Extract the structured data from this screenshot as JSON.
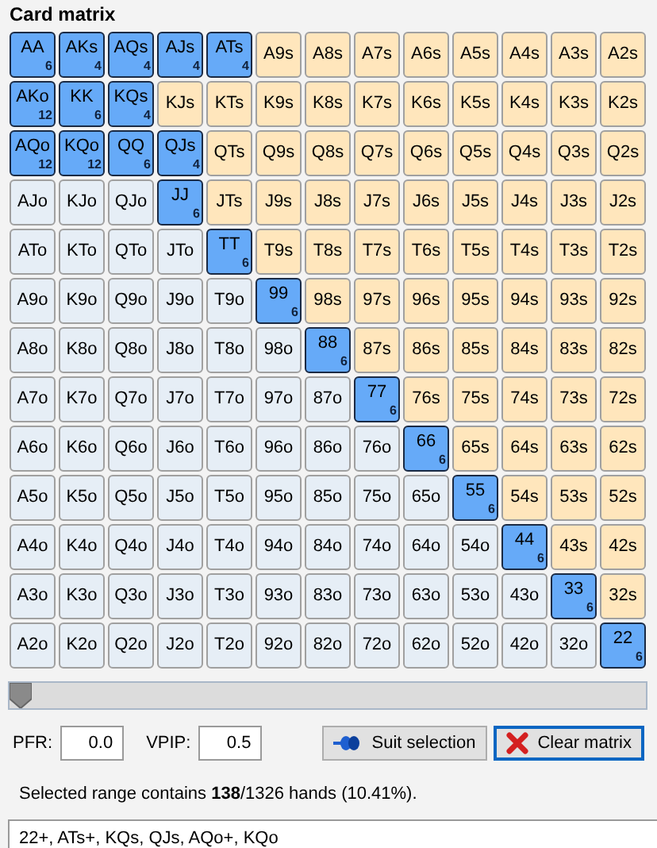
{
  "title": "Card matrix",
  "matrix": [
    [
      {
        "label": "AA",
        "selected": true,
        "combos": "6"
      },
      {
        "label": "AKs",
        "selected": true,
        "combos": "4"
      },
      {
        "label": "AQs",
        "selected": true,
        "combos": "4"
      },
      {
        "label": "AJs",
        "selected": true,
        "combos": "4"
      },
      {
        "label": "ATs",
        "selected": true,
        "combos": "4"
      },
      {
        "label": "A9s",
        "kind": "suited",
        "selected": false
      },
      {
        "label": "A8s",
        "kind": "suited",
        "selected": false
      },
      {
        "label": "A7s",
        "kind": "suited",
        "selected": false
      },
      {
        "label": "A6s",
        "kind": "suited",
        "selected": false
      },
      {
        "label": "A5s",
        "kind": "suited",
        "selected": false
      },
      {
        "label": "A4s",
        "kind": "suited",
        "selected": false
      },
      {
        "label": "A3s",
        "kind": "suited",
        "selected": false
      },
      {
        "label": "A2s",
        "kind": "suited",
        "selected": false
      }
    ],
    [
      {
        "label": "AKo",
        "selected": true,
        "combos": "12"
      },
      {
        "label": "KK",
        "selected": true,
        "combos": "6"
      },
      {
        "label": "KQs",
        "selected": true,
        "combos": "4"
      },
      {
        "label": "KJs",
        "kind": "suited",
        "selected": false
      },
      {
        "label": "KTs",
        "kind": "suited",
        "selected": false
      },
      {
        "label": "K9s",
        "kind": "suited",
        "selected": false
      },
      {
        "label": "K8s",
        "kind": "suited",
        "selected": false
      },
      {
        "label": "K7s",
        "kind": "suited",
        "selected": false
      },
      {
        "label": "K6s",
        "kind": "suited",
        "selected": false
      },
      {
        "label": "K5s",
        "kind": "suited",
        "selected": false
      },
      {
        "label": "K4s",
        "kind": "suited",
        "selected": false
      },
      {
        "label": "K3s",
        "kind": "suited",
        "selected": false
      },
      {
        "label": "K2s",
        "kind": "suited",
        "selected": false
      }
    ],
    [
      {
        "label": "AQo",
        "selected": true,
        "combos": "12"
      },
      {
        "label": "KQo",
        "selected": true,
        "combos": "12"
      },
      {
        "label": "QQ",
        "selected": true,
        "combos": "6"
      },
      {
        "label": "QJs",
        "selected": true,
        "combos": "4"
      },
      {
        "label": "QTs",
        "kind": "suited",
        "selected": false
      },
      {
        "label": "Q9s",
        "kind": "suited",
        "selected": false
      },
      {
        "label": "Q8s",
        "kind": "suited",
        "selected": false
      },
      {
        "label": "Q7s",
        "kind": "suited",
        "selected": false
      },
      {
        "label": "Q6s",
        "kind": "suited",
        "selected": false
      },
      {
        "label": "Q5s",
        "kind": "suited",
        "selected": false
      },
      {
        "label": "Q4s",
        "kind": "suited",
        "selected": false
      },
      {
        "label": "Q3s",
        "kind": "suited",
        "selected": false
      },
      {
        "label": "Q2s",
        "kind": "suited",
        "selected": false
      }
    ],
    [
      {
        "label": "AJo",
        "kind": "offsuit",
        "selected": false
      },
      {
        "label": "KJo",
        "kind": "offsuit",
        "selected": false
      },
      {
        "label": "QJo",
        "kind": "offsuit",
        "selected": false
      },
      {
        "label": "JJ",
        "selected": true,
        "combos": "6"
      },
      {
        "label": "JTs",
        "kind": "suited",
        "selected": false
      },
      {
        "label": "J9s",
        "kind": "suited",
        "selected": false
      },
      {
        "label": "J8s",
        "kind": "suited",
        "selected": false
      },
      {
        "label": "J7s",
        "kind": "suited",
        "selected": false
      },
      {
        "label": "J6s",
        "kind": "suited",
        "selected": false
      },
      {
        "label": "J5s",
        "kind": "suited",
        "selected": false
      },
      {
        "label": "J4s",
        "kind": "suited",
        "selected": false
      },
      {
        "label": "J3s",
        "kind": "suited",
        "selected": false
      },
      {
        "label": "J2s",
        "kind": "suited",
        "selected": false
      }
    ],
    [
      {
        "label": "ATo",
        "kind": "offsuit",
        "selected": false
      },
      {
        "label": "KTo",
        "kind": "offsuit",
        "selected": false
      },
      {
        "label": "QTo",
        "kind": "offsuit",
        "selected": false
      },
      {
        "label": "JTo",
        "kind": "offsuit",
        "selected": false
      },
      {
        "label": "TT",
        "selected": true,
        "combos": "6"
      },
      {
        "label": "T9s",
        "kind": "suited",
        "selected": false
      },
      {
        "label": "T8s",
        "kind": "suited",
        "selected": false
      },
      {
        "label": "T7s",
        "kind": "suited",
        "selected": false
      },
      {
        "label": "T6s",
        "kind": "suited",
        "selected": false
      },
      {
        "label": "T5s",
        "kind": "suited",
        "selected": false
      },
      {
        "label": "T4s",
        "kind": "suited",
        "selected": false
      },
      {
        "label": "T3s",
        "kind": "suited",
        "selected": false
      },
      {
        "label": "T2s",
        "kind": "suited",
        "selected": false
      }
    ],
    [
      {
        "label": "A9o",
        "kind": "offsuit",
        "selected": false
      },
      {
        "label": "K9o",
        "kind": "offsuit",
        "selected": false
      },
      {
        "label": "Q9o",
        "kind": "offsuit",
        "selected": false
      },
      {
        "label": "J9o",
        "kind": "offsuit",
        "selected": false
      },
      {
        "label": "T9o",
        "kind": "offsuit",
        "selected": false
      },
      {
        "label": "99",
        "selected": true,
        "combos": "6"
      },
      {
        "label": "98s",
        "kind": "suited",
        "selected": false
      },
      {
        "label": "97s",
        "kind": "suited",
        "selected": false
      },
      {
        "label": "96s",
        "kind": "suited",
        "selected": false
      },
      {
        "label": "95s",
        "kind": "suited",
        "selected": false
      },
      {
        "label": "94s",
        "kind": "suited",
        "selected": false
      },
      {
        "label": "93s",
        "kind": "suited",
        "selected": false
      },
      {
        "label": "92s",
        "kind": "suited",
        "selected": false
      }
    ],
    [
      {
        "label": "A8o",
        "kind": "offsuit",
        "selected": false
      },
      {
        "label": "K8o",
        "kind": "offsuit",
        "selected": false
      },
      {
        "label": "Q8o",
        "kind": "offsuit",
        "selected": false
      },
      {
        "label": "J8o",
        "kind": "offsuit",
        "selected": false
      },
      {
        "label": "T8o",
        "kind": "offsuit",
        "selected": false
      },
      {
        "label": "98o",
        "kind": "offsuit",
        "selected": false
      },
      {
        "label": "88",
        "selected": true,
        "combos": "6"
      },
      {
        "label": "87s",
        "kind": "suited",
        "selected": false
      },
      {
        "label": "86s",
        "kind": "suited",
        "selected": false
      },
      {
        "label": "85s",
        "kind": "suited",
        "selected": false
      },
      {
        "label": "84s",
        "kind": "suited",
        "selected": false
      },
      {
        "label": "83s",
        "kind": "suited",
        "selected": false
      },
      {
        "label": "82s",
        "kind": "suited",
        "selected": false
      }
    ],
    [
      {
        "label": "A7o",
        "kind": "offsuit",
        "selected": false
      },
      {
        "label": "K7o",
        "kind": "offsuit",
        "selected": false
      },
      {
        "label": "Q7o",
        "kind": "offsuit",
        "selected": false
      },
      {
        "label": "J7o",
        "kind": "offsuit",
        "selected": false
      },
      {
        "label": "T7o",
        "kind": "offsuit",
        "selected": false
      },
      {
        "label": "97o",
        "kind": "offsuit",
        "selected": false
      },
      {
        "label": "87o",
        "kind": "offsuit",
        "selected": false
      },
      {
        "label": "77",
        "selected": true,
        "combos": "6"
      },
      {
        "label": "76s",
        "kind": "suited",
        "selected": false
      },
      {
        "label": "75s",
        "kind": "suited",
        "selected": false
      },
      {
        "label": "74s",
        "kind": "suited",
        "selected": false
      },
      {
        "label": "73s",
        "kind": "suited",
        "selected": false
      },
      {
        "label": "72s",
        "kind": "suited",
        "selected": false
      }
    ],
    [
      {
        "label": "A6o",
        "kind": "offsuit",
        "selected": false
      },
      {
        "label": "K6o",
        "kind": "offsuit",
        "selected": false
      },
      {
        "label": "Q6o",
        "kind": "offsuit",
        "selected": false
      },
      {
        "label": "J6o",
        "kind": "offsuit",
        "selected": false
      },
      {
        "label": "T6o",
        "kind": "offsuit",
        "selected": false
      },
      {
        "label": "96o",
        "kind": "offsuit",
        "selected": false
      },
      {
        "label": "86o",
        "kind": "offsuit",
        "selected": false
      },
      {
        "label": "76o",
        "kind": "offsuit",
        "selected": false
      },
      {
        "label": "66",
        "selected": true,
        "combos": "6"
      },
      {
        "label": "65s",
        "kind": "suited",
        "selected": false
      },
      {
        "label": "64s",
        "kind": "suited",
        "selected": false
      },
      {
        "label": "63s",
        "kind": "suited",
        "selected": false
      },
      {
        "label": "62s",
        "kind": "suited",
        "selected": false
      }
    ],
    [
      {
        "label": "A5o",
        "kind": "offsuit",
        "selected": false
      },
      {
        "label": "K5o",
        "kind": "offsuit",
        "selected": false
      },
      {
        "label": "Q5o",
        "kind": "offsuit",
        "selected": false
      },
      {
        "label": "J5o",
        "kind": "offsuit",
        "selected": false
      },
      {
        "label": "T5o",
        "kind": "offsuit",
        "selected": false
      },
      {
        "label": "95o",
        "kind": "offsuit",
        "selected": false
      },
      {
        "label": "85o",
        "kind": "offsuit",
        "selected": false
      },
      {
        "label": "75o",
        "kind": "offsuit",
        "selected": false
      },
      {
        "label": "65o",
        "kind": "offsuit",
        "selected": false
      },
      {
        "label": "55",
        "selected": true,
        "combos": "6"
      },
      {
        "label": "54s",
        "kind": "suited",
        "selected": false
      },
      {
        "label": "53s",
        "kind": "suited",
        "selected": false
      },
      {
        "label": "52s",
        "kind": "suited",
        "selected": false
      }
    ],
    [
      {
        "label": "A4o",
        "kind": "offsuit",
        "selected": false
      },
      {
        "label": "K4o",
        "kind": "offsuit",
        "selected": false
      },
      {
        "label": "Q4o",
        "kind": "offsuit",
        "selected": false
      },
      {
        "label": "J4o",
        "kind": "offsuit",
        "selected": false
      },
      {
        "label": "T4o",
        "kind": "offsuit",
        "selected": false
      },
      {
        "label": "94o",
        "kind": "offsuit",
        "selected": false
      },
      {
        "label": "84o",
        "kind": "offsuit",
        "selected": false
      },
      {
        "label": "74o",
        "kind": "offsuit",
        "selected": false
      },
      {
        "label": "64o",
        "kind": "offsuit",
        "selected": false
      },
      {
        "label": "54o",
        "kind": "offsuit",
        "selected": false
      },
      {
        "label": "44",
        "selected": true,
        "combos": "6"
      },
      {
        "label": "43s",
        "kind": "suited",
        "selected": false
      },
      {
        "label": "42s",
        "kind": "suited",
        "selected": false
      }
    ],
    [
      {
        "label": "A3o",
        "kind": "offsuit",
        "selected": false
      },
      {
        "label": "K3o",
        "kind": "offsuit",
        "selected": false
      },
      {
        "label": "Q3o",
        "kind": "offsuit",
        "selected": false
      },
      {
        "label": "J3o",
        "kind": "offsuit",
        "selected": false
      },
      {
        "label": "T3o",
        "kind": "offsuit",
        "selected": false
      },
      {
        "label": "93o",
        "kind": "offsuit",
        "selected": false
      },
      {
        "label": "83o",
        "kind": "offsuit",
        "selected": false
      },
      {
        "label": "73o",
        "kind": "offsuit",
        "selected": false
      },
      {
        "label": "63o",
        "kind": "offsuit",
        "selected": false
      },
      {
        "label": "53o",
        "kind": "offsuit",
        "selected": false
      },
      {
        "label": "43o",
        "kind": "offsuit",
        "selected": false
      },
      {
        "label": "33",
        "selected": true,
        "combos": "6"
      },
      {
        "label": "32s",
        "kind": "suited",
        "selected": false
      }
    ],
    [
      {
        "label": "A2o",
        "kind": "offsuit",
        "selected": false
      },
      {
        "label": "K2o",
        "kind": "offsuit",
        "selected": false
      },
      {
        "label": "Q2o",
        "kind": "offsuit",
        "selected": false
      },
      {
        "label": "J2o",
        "kind": "offsuit",
        "selected": false
      },
      {
        "label": "T2o",
        "kind": "offsuit",
        "selected": false
      },
      {
        "label": "92o",
        "kind": "offsuit",
        "selected": false
      },
      {
        "label": "82o",
        "kind": "offsuit",
        "selected": false
      },
      {
        "label": "72o",
        "kind": "offsuit",
        "selected": false
      },
      {
        "label": "62o",
        "kind": "offsuit",
        "selected": false
      },
      {
        "label": "52o",
        "kind": "offsuit",
        "selected": false
      },
      {
        "label": "42o",
        "kind": "offsuit",
        "selected": false
      },
      {
        "label": "32o",
        "kind": "offsuit",
        "selected": false
      },
      {
        "label": "22",
        "selected": true,
        "combos": "6"
      }
    ]
  ],
  "slider": {
    "level": 0
  },
  "pfr": {
    "label": "PFR:",
    "value": "0.0"
  },
  "vpip": {
    "label": "VPIP:",
    "value": "0.5"
  },
  "buttons": [
    {
      "kind": "suit",
      "label": "Suit selection",
      "focused": false
    },
    {
      "kind": "clear",
      "label": "Clear matrix",
      "focused": true
    }
  ],
  "summary": "Selected range contains **138**/1326 hands (10.41%).",
  "range": {
    "value": "22+, ATs+, KQs, QJs, AQo+, KQo"
  }
}
